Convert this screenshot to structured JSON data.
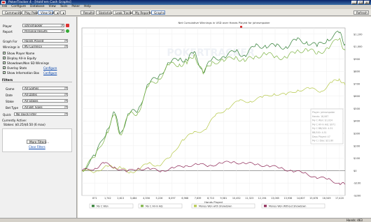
{
  "window": {
    "title": "PokerTracker 4 - [Hold'em Cash Graphs]"
  },
  "menu": [
    "File",
    "Configure",
    "Database",
    "View",
    "Tools",
    "Poker",
    "Help"
  ],
  "toolbar": {
    "left_buttons": [
      "Community",
      "Play Poker",
      "View Stats"
    ],
    "center_buttons": [
      "Results",
      "Statistics",
      "Leak Tracker",
      "My Reports",
      "Graphs"
    ],
    "right_link": "Date on this Report is Filtered",
    "refresh": "Refresh"
  },
  "left": {
    "player_label": "Player",
    "player_value": "johnsmpoker",
    "report_label": "Report",
    "report_value": "Personal Results",
    "graph_for_label": "Graph For",
    "graph_for_value": "Hands Played",
    "winnings_label": "Winnings in",
    "winnings_value": "My Currency",
    "checks": [
      "Show Player Name",
      "Display All-in Equity",
      "Showdown/Non SD Winnings",
      "Overlay Stats",
      "Show Information Box"
    ],
    "configure": "Configure",
    "filters_title": "Filters",
    "filter_rows": [
      {
        "label": "Game",
        "value": "All Games"
      },
      {
        "label": "Date",
        "value": "All Dates"
      },
      {
        "label": "Stake",
        "value": "All Stakes"
      },
      {
        "label": "Bet Type",
        "value": "All Bet Types"
      }
    ],
    "quick_label": "Quick",
    "quick_value": "No Quick Filter",
    "currently_active": "Currently Active:",
    "active_value": "Stakes: $0.25/$0.50 (6 max)",
    "more_filters": "More Filters...",
    "clear_filters": "Clear Filters"
  },
  "colors": {
    "all_in_adj": "#7cb342",
    "net_won": "#2e7d32",
    "showdown": "#b5c848",
    "non_showdown": "#8b2252"
  },
  "chart_data": {
    "type": "line",
    "title": "Net Cumulative Winnings in USD over Hands Played for johnsmpoker",
    "xlabel": "Hands Played",
    "x_ticks": [
      "871",
      "1,742",
      "2,613",
      "3,484",
      "4,356",
      "5,226",
      "6,097",
      "6,968",
      "7,839",
      "8,710",
      "9,581",
      "10,452",
      "11,323",
      "12,194",
      "13,065",
      "13,936",
      "14,807",
      "15,678",
      "16,549",
      "17,420"
    ],
    "y_ticks": [
      "$1,100",
      "$1,000",
      "$900",
      "$800",
      "$700",
      "$600",
      "$500",
      "$400",
      "$300",
      "$200",
      "$100",
      "$0",
      "-$100",
      "-$200"
    ],
    "ylim": [
      -200,
      1150
    ],
    "xlim": [
      0,
      17800
    ],
    "series": [
      {
        "name": "My C Won",
        "values": [
          [
            0,
            0
          ],
          [
            900,
            120
          ],
          [
            1700,
            330
          ],
          [
            2200,
            470
          ],
          [
            2600,
            300
          ],
          [
            3200,
            460
          ],
          [
            3800,
            490
          ],
          [
            4500,
            700
          ],
          [
            5200,
            760
          ],
          [
            5900,
            870
          ],
          [
            6600,
            900
          ],
          [
            7100,
            890
          ],
          [
            7600,
            960
          ],
          [
            8200,
            790
          ],
          [
            8800,
            900
          ],
          [
            9600,
            920
          ],
          [
            10400,
            960
          ],
          [
            11000,
            930
          ],
          [
            11700,
            1000
          ],
          [
            12400,
            1010
          ],
          [
            13100,
            1000
          ],
          [
            13800,
            1000
          ],
          [
            14500,
            1050
          ],
          [
            15200,
            1040
          ],
          [
            15900,
            1000
          ],
          [
            16600,
            1060
          ],
          [
            17400,
            1110
          ],
          [
            17800,
            1020
          ]
        ]
      },
      {
        "name": "My C All-in Adj",
        "values": [
          [
            0,
            0
          ],
          [
            900,
            110
          ],
          [
            1700,
            310
          ],
          [
            2200,
            450
          ],
          [
            2600,
            290
          ],
          [
            3200,
            450
          ],
          [
            3800,
            470
          ],
          [
            4500,
            680
          ],
          [
            5200,
            740
          ],
          [
            5900,
            850
          ],
          [
            6600,
            860
          ],
          [
            7100,
            860
          ],
          [
            7600,
            940
          ],
          [
            8200,
            780
          ],
          [
            8800,
            880
          ],
          [
            9600,
            880
          ],
          [
            10400,
            920
          ],
          [
            11000,
            880
          ],
          [
            11700,
            920
          ],
          [
            12400,
            940
          ],
          [
            13100,
            920
          ],
          [
            13800,
            910
          ],
          [
            14500,
            960
          ],
          [
            15200,
            980
          ],
          [
            15900,
            940
          ],
          [
            16600,
            990
          ],
          [
            17400,
            1060
          ],
          [
            17800,
            970
          ]
        ]
      },
      {
        "name": "Money Won with Showdown",
        "values": [
          [
            0,
            0
          ],
          [
            900,
            -10
          ],
          [
            1700,
            40
          ],
          [
            2200,
            20
          ],
          [
            2600,
            30
          ],
          [
            3200,
            -20
          ],
          [
            3800,
            10
          ],
          [
            4500,
            60
          ],
          [
            5200,
            40
          ],
          [
            6000,
            110
          ],
          [
            6800,
            250
          ],
          [
            7500,
            300
          ],
          [
            8300,
            330
          ],
          [
            9000,
            440
          ],
          [
            9800,
            500
          ],
          [
            10600,
            560
          ],
          [
            11400,
            560
          ],
          [
            12200,
            590
          ],
          [
            13000,
            620
          ],
          [
            13800,
            610
          ],
          [
            14600,
            650
          ],
          [
            15400,
            660
          ],
          [
            16200,
            640
          ],
          [
            16900,
            710
          ],
          [
            17400,
            740
          ],
          [
            17800,
            690
          ]
        ]
      },
      {
        "name": "Money Won Without Showdown",
        "values": [
          [
            0,
            0
          ],
          [
            900,
            20
          ],
          [
            1500,
            60
          ],
          [
            2200,
            30
          ],
          [
            3000,
            -10
          ],
          [
            3800,
            20
          ],
          [
            4600,
            10
          ],
          [
            5400,
            0
          ],
          [
            6200,
            20
          ],
          [
            7000,
            40
          ],
          [
            7800,
            50
          ],
          [
            8600,
            40
          ],
          [
            9400,
            60
          ],
          [
            10200,
            70
          ],
          [
            11000,
            60
          ],
          [
            11800,
            50
          ],
          [
            12600,
            40
          ],
          [
            13400,
            20
          ],
          [
            14200,
            0
          ],
          [
            15000,
            -20
          ],
          [
            15800,
            -50
          ],
          [
            16600,
            -70
          ],
          [
            17400,
            -100
          ],
          [
            17800,
            -110
          ]
        ]
      }
    ],
    "info_box": [
      "Player: johnsmpoker",
      "Hands: 18,067",
      "My C Won: $1,024",
      "My C All-in Adj: $971",
      "My C BB/100: 4.51",
      "BB/100: 4.51",
      "Days Played: 47",
      "My C / Day: $21.80"
    ],
    "watermark": "POKERTRACKER"
  },
  "status": {
    "hands": "Hands: 463"
  }
}
